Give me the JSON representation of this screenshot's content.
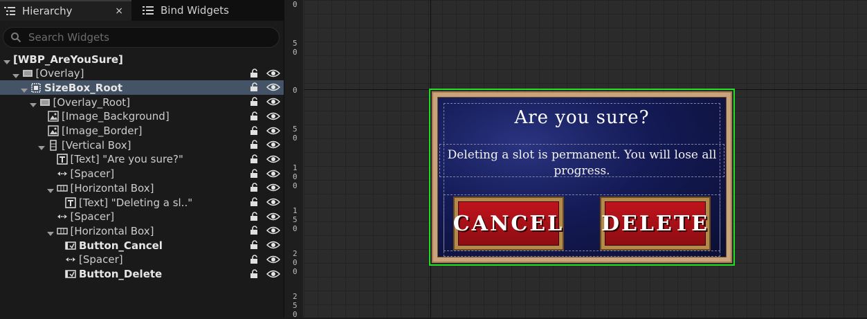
{
  "tabs": {
    "hierarchy_label": "Hierarchy",
    "close_label": "×",
    "bind_widgets_label": "Bind Widgets"
  },
  "search": {
    "placeholder": "Search Widgets",
    "value": ""
  },
  "tree": [
    {
      "label": "[WBP_AreYouSure]",
      "bold": true,
      "indent": 0,
      "icon": "none",
      "expanded": true,
      "locks": false
    },
    {
      "label": "[Overlay]",
      "bold": false,
      "indent": 1,
      "icon": "overlay-icon",
      "expanded": true,
      "locks": true
    },
    {
      "label": "SizeBox_Root",
      "bold": true,
      "indent": 2,
      "icon": "sizebox-icon",
      "expanded": true,
      "locks": true,
      "selected": true
    },
    {
      "label": "[Overlay_Root]",
      "bold": false,
      "indent": 3,
      "icon": "overlay-icon",
      "expanded": true,
      "locks": true
    },
    {
      "label": "[Image_Background]",
      "bold": false,
      "indent": 4,
      "icon": "image-icon",
      "expanded": null,
      "locks": true
    },
    {
      "label": "[Image_Border]",
      "bold": false,
      "indent": 4,
      "icon": "image-icon",
      "expanded": null,
      "locks": true
    },
    {
      "label": "[Vertical Box]",
      "bold": false,
      "indent": 4,
      "icon": "vbox-icon",
      "expanded": true,
      "locks": true
    },
    {
      "label": "[Text] \"Are you sure?\"",
      "bold": false,
      "indent": 5,
      "icon": "text-icon",
      "expanded": null,
      "locks": true
    },
    {
      "label": "[Spacer]",
      "bold": false,
      "indent": 5,
      "icon": "spacer-icon",
      "expanded": null,
      "locks": true
    },
    {
      "label": "[Horizontal Box]",
      "bold": false,
      "indent": 5,
      "icon": "hbox-icon",
      "expanded": true,
      "locks": true
    },
    {
      "label": "[Text] \"Deleting a sl..\"",
      "bold": false,
      "indent": 6,
      "icon": "text-icon",
      "expanded": null,
      "locks": true
    },
    {
      "label": "[Spacer]",
      "bold": false,
      "indent": 5,
      "icon": "spacer-icon",
      "expanded": null,
      "locks": true
    },
    {
      "label": "[Horizontal Box]",
      "bold": false,
      "indent": 5,
      "icon": "hbox-icon",
      "expanded": true,
      "locks": true
    },
    {
      "label": "Button_Cancel",
      "bold": true,
      "indent": 6,
      "icon": "button-icon",
      "expanded": null,
      "locks": true
    },
    {
      "label": "[Spacer]",
      "bold": false,
      "indent": 6,
      "icon": "spacer-icon",
      "expanded": null,
      "locks": true
    },
    {
      "label": "Button_Delete",
      "bold": true,
      "indent": 6,
      "icon": "button-icon",
      "expanded": null,
      "locks": true
    }
  ],
  "ruler": {
    "labels": [
      "0",
      "5 0",
      "0",
      "5 0",
      "1 0 0",
      "1 5 0",
      "2 0 0",
      "2 5 0"
    ]
  },
  "dialog": {
    "title": "Are you sure?",
    "message": "Deleting a slot is permanent. You will lose all progress.",
    "cancel_label": "CANCEL",
    "delete_label": "DELETE"
  },
  "colors": {
    "selection": "#445466",
    "widget_outline": "#22e022",
    "button_red": "#b0121a",
    "panel_blue": "#141a55"
  }
}
